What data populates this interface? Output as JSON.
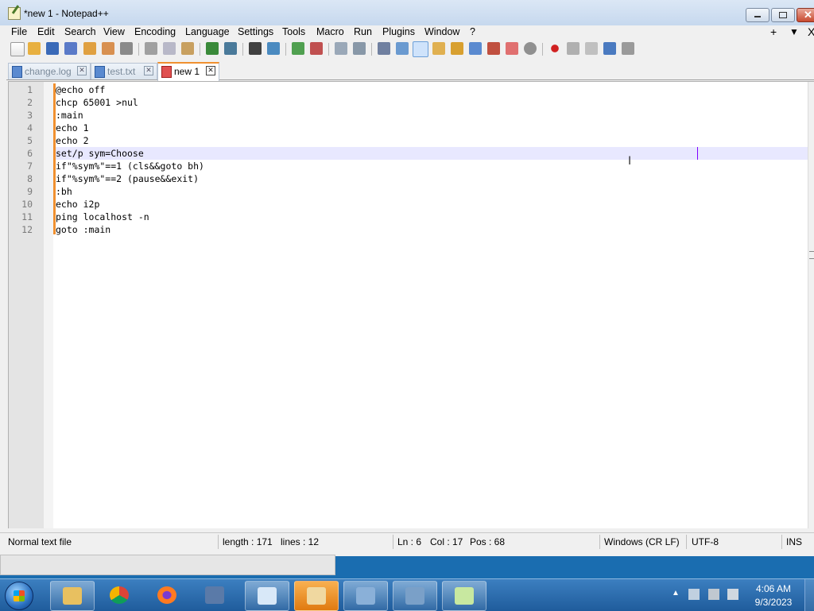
{
  "window": {
    "title": "*new 1 - Notepad++"
  },
  "menu": {
    "items": [
      "File",
      "Edit",
      "Search",
      "View",
      "Encoding",
      "Language",
      "Settings",
      "Tools",
      "Macro",
      "Run",
      "Plugins",
      "Window",
      "?"
    ],
    "right": {
      "plus": "+",
      "down": "▼",
      "close": "X"
    }
  },
  "toolbar": {
    "icons": [
      "new-file",
      "open-file",
      "save",
      "save-all",
      "close",
      "close-all",
      "print",
      "cut",
      "copy",
      "paste",
      "undo",
      "redo",
      "find",
      "replace",
      "zoom-in",
      "zoom-out",
      "sync-vertical",
      "sync-horizontal",
      "word-wrap",
      "show-all-characters",
      "indent-guide",
      "user-defined-language",
      "document-map",
      "function-list",
      "folder-as-workspace",
      "monitoring",
      "record-macro",
      "stop-recording",
      "play-macro",
      "run-macro-multiple",
      "save-macro"
    ]
  },
  "tabs": [
    {
      "label": "change.log",
      "active": false
    },
    {
      "label": "test.txt",
      "active": false
    },
    {
      "label": "new 1",
      "active": true
    }
  ],
  "editor": {
    "lines": [
      {
        "num": "1",
        "text": "@echo off"
      },
      {
        "num": "2",
        "text": "chcp 65001 >nul"
      },
      {
        "num": "3",
        "text": ":main"
      },
      {
        "num": "4",
        "text": "echo 1"
      },
      {
        "num": "5",
        "text": "echo 2"
      },
      {
        "num": "6",
        "text": "set/p sym=Choose"
      },
      {
        "num": "7",
        "text": "if\"%sym%\"==1 (cls&&goto bh)"
      },
      {
        "num": "8",
        "text": "if\"%sym%\"==2 (pause&&exit)"
      },
      {
        "num": "9",
        "text": ":bh"
      },
      {
        "num": "10",
        "text": "echo i2p"
      },
      {
        "num": "11",
        "text": "ping localhost -n"
      },
      {
        "num": "12",
        "text": "goto :main"
      }
    ],
    "current_line": 6
  },
  "status": {
    "file_type": "Normal text file",
    "length": "length : 171",
    "lines": "lines : 12",
    "ln": "Ln : 6",
    "col": "Col : 17",
    "pos": "Pos : 68",
    "eol": "Windows (CR LF)",
    "encoding": "UTF-8",
    "mode": "INS"
  },
  "taskbar": {
    "apps": [
      "windows-explorer",
      "google-chrome",
      "firefox",
      "virtualbox",
      "file-manager",
      "media-player",
      "control-panel",
      "remote-desktop",
      "notepad-plus-plus"
    ],
    "time": "4:06 AM",
    "date": "9/3/2023"
  },
  "colors": {
    "accent_tab": "#f09030",
    "current_line": "#e8e8ff",
    "caret": "#8000ff",
    "taskbar": "#1f5c9c"
  }
}
